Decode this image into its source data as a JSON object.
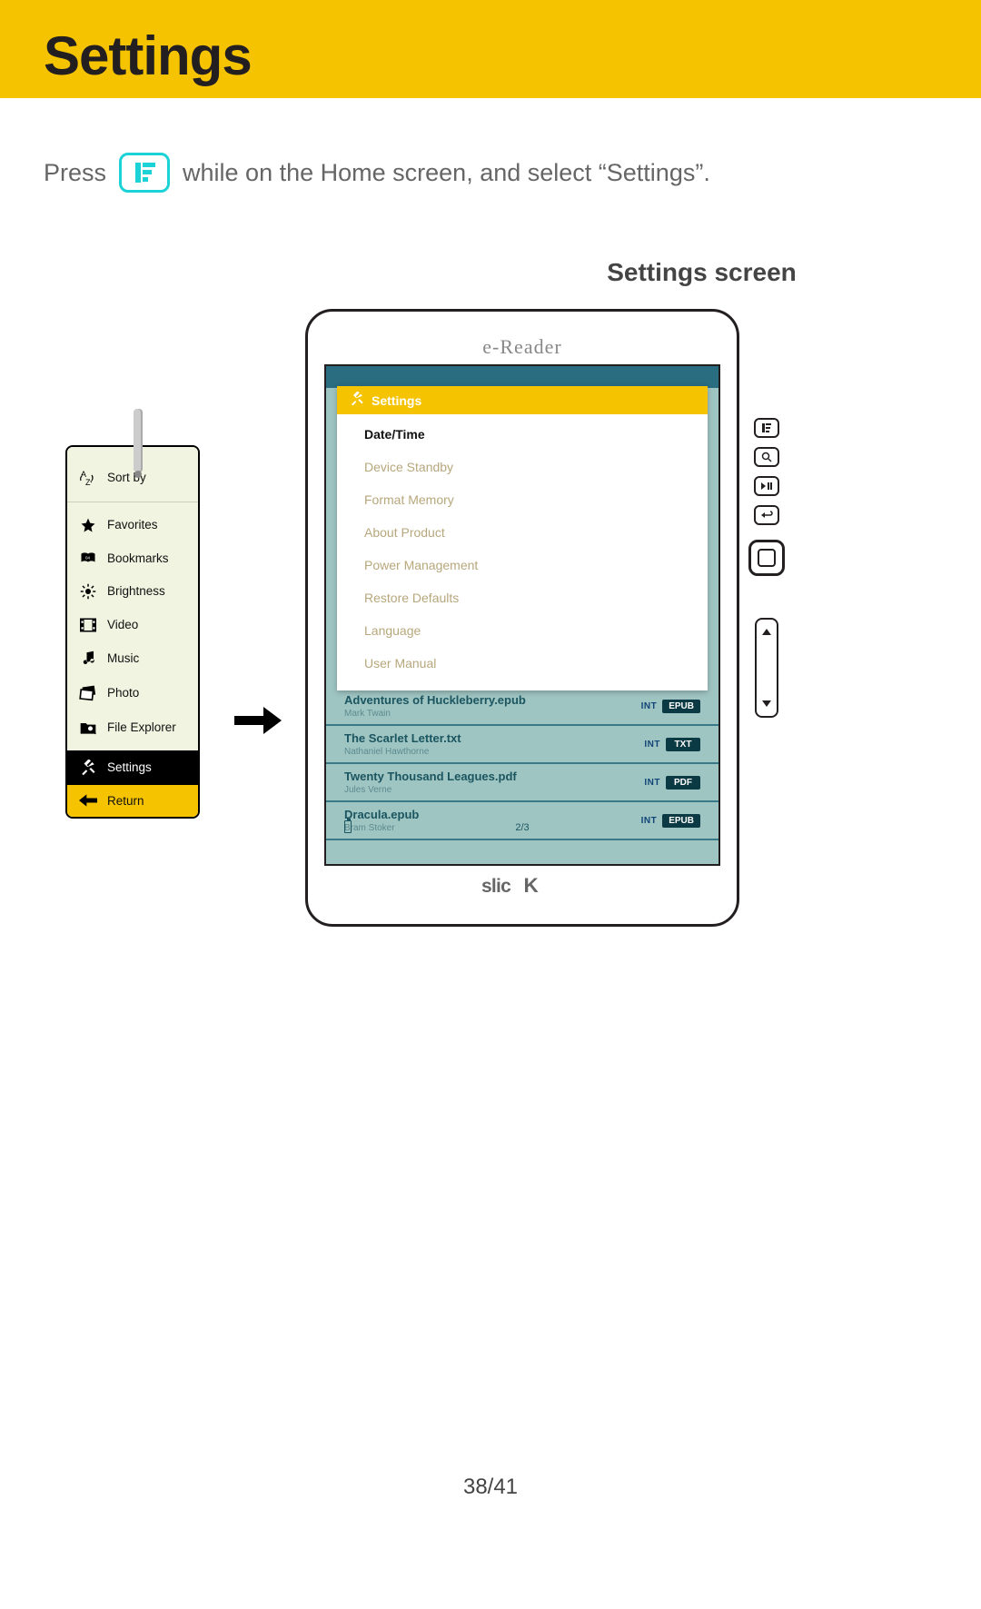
{
  "header": {
    "title": "Settings"
  },
  "instruction": {
    "pre": "Press",
    "post": "while on the Home screen, and select “Settings”."
  },
  "subtitle": "Settings screen",
  "menu": {
    "sort_by": "Sort by",
    "items": [
      {
        "label": "Favorites"
      },
      {
        "label": "Bookmarks"
      },
      {
        "label": "Brightness"
      },
      {
        "label": "Video"
      },
      {
        "label": "Music"
      },
      {
        "label": "Photo"
      },
      {
        "label": "File Explorer"
      }
    ],
    "settings": "Settings",
    "return": "Return"
  },
  "device": {
    "label": "e-Reader",
    "brand": "slicK",
    "overlay_title": "Settings",
    "settings_items": [
      {
        "label": "Date/Time",
        "active": true
      },
      {
        "label": "Device Standby"
      },
      {
        "label": "Format Memory"
      },
      {
        "label": "About Product"
      },
      {
        "label": "Power Management"
      },
      {
        "label": "Restore Defaults"
      },
      {
        "label": "Language"
      },
      {
        "label": "User Manual"
      }
    ],
    "books": [
      {
        "title": "Adventures of Huckleberry.epub",
        "author": "Mark Twain",
        "loc": "INT",
        "fmt": "EPUB"
      },
      {
        "title": "The Scarlet Letter.txt",
        "author": "Nathaniel Hawthorne",
        "loc": "INT",
        "fmt": "TXT"
      },
      {
        "title": "Twenty Thousand Leagues.pdf",
        "author": "Jules Verne",
        "loc": "INT",
        "fmt": "PDF"
      },
      {
        "title": "Dracula.epub",
        "author": "Bram Stoker",
        "loc": "INT",
        "fmt": "EPUB"
      }
    ],
    "page_indicator": "2/3"
  },
  "page_number": "38/41"
}
